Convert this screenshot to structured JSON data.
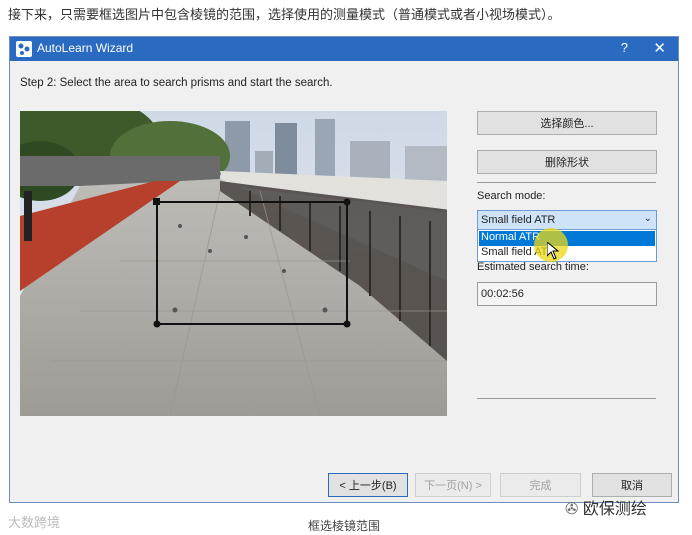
{
  "article": {
    "intro_text": "接下来，只需要框选图片中包含棱镜的范围，选择使用的测量模式（普通模式或者小视场模式）。",
    "figure_caption": "框选棱镜范围",
    "watermark_left": "大数跨境",
    "watermark_right": "欧保测绘"
  },
  "window": {
    "title": "AutoLearn Wizard",
    "help_label": "?",
    "close_label": "✕",
    "app_icon": "wizard-app-icon",
    "titlebar_color": "#2b6ac1"
  },
  "step": {
    "label": "Step 2: Select the area to search prisms and start the search."
  },
  "side_panel": {
    "select_color_label": "选择颜色...",
    "delete_shape_label": "删除形状",
    "search_mode_label": "Search mode:",
    "search_mode_value": "Small field ATR",
    "search_mode_options": [
      "Normal ATR",
      "Small field ATR"
    ],
    "search_mode_highlighted": "Normal ATR",
    "estimated_time_label": "Estimated search time:",
    "estimated_time_value": "00:02:56"
  },
  "footer": {
    "back_label": "< 上一步(B)",
    "next_label": "下一页(N) >",
    "finish_label": "完成",
    "cancel_label": "取消"
  },
  "colors": {
    "selection_blue": "#0078d7",
    "cursor_highlight": "#ebd714",
    "running_track": "#b6402c"
  }
}
